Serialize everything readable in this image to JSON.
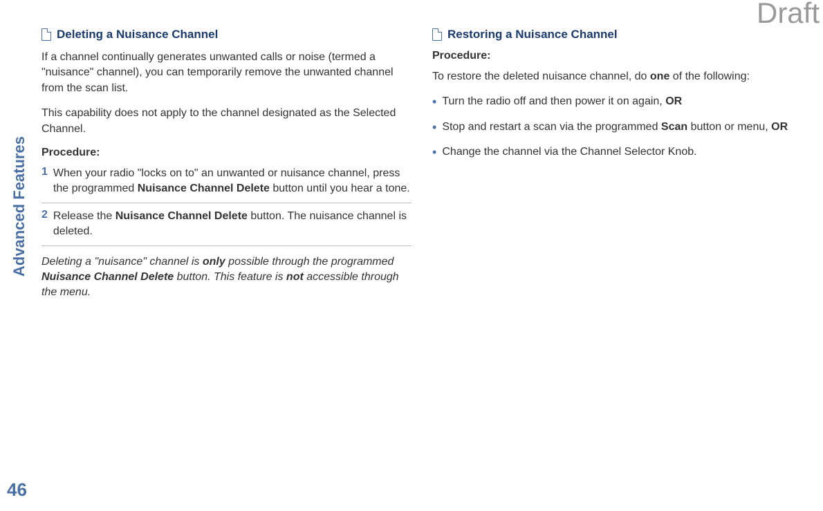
{
  "watermark": "Draft",
  "vertical_label": "Advanced Features",
  "page_number": "46",
  "left_column": {
    "heading": "Deleting a Nuisance Channel",
    "para1": "If a channel continually generates unwanted calls or noise (termed a \"nuisance\" channel), you can temporarily remove the unwanted channel from the scan list.",
    "para2": "This capability does not apply to the channel designated as the Selected Channel.",
    "procedure_label": "Procedure:",
    "steps": [
      {
        "num": "1",
        "text_before": "When your radio \"locks on to\" an unwanted or nuisance channel, press the programmed ",
        "bold": "Nuisance Channel Delete",
        "text_after": " button until you hear a tone."
      },
      {
        "num": "2",
        "text_before": "Release the ",
        "bold": "Nuisance Channel Delete",
        "text_after": " button. The nuisance channel is deleted."
      }
    ],
    "note": {
      "p1": "Deleting a \"nuisance\" channel is ",
      "b1": "only",
      "p2": " possible through the programmed ",
      "b2": "Nuisance Channel Delete",
      "p3": " button. This feature is ",
      "b3": "not",
      "p4": " accessible through the menu."
    }
  },
  "right_column": {
    "heading": "Restoring a Nuisance Channel",
    "procedure_label": "Procedure:",
    "intro_before": "To restore the deleted nuisance channel, do ",
    "intro_bold": "one",
    "intro_after": " of the following:",
    "bullets": [
      {
        "text_before": "Turn the radio off and then power it on again, ",
        "bold_end": "OR"
      },
      {
        "text_before": "Stop and restart a scan via the programmed ",
        "bold_mid": "Scan",
        "text_mid": " button or menu, ",
        "bold_end": "OR"
      },
      {
        "text_before": "Change the channel via the Channel Selector Knob.",
        "bold_end": ""
      }
    ]
  }
}
